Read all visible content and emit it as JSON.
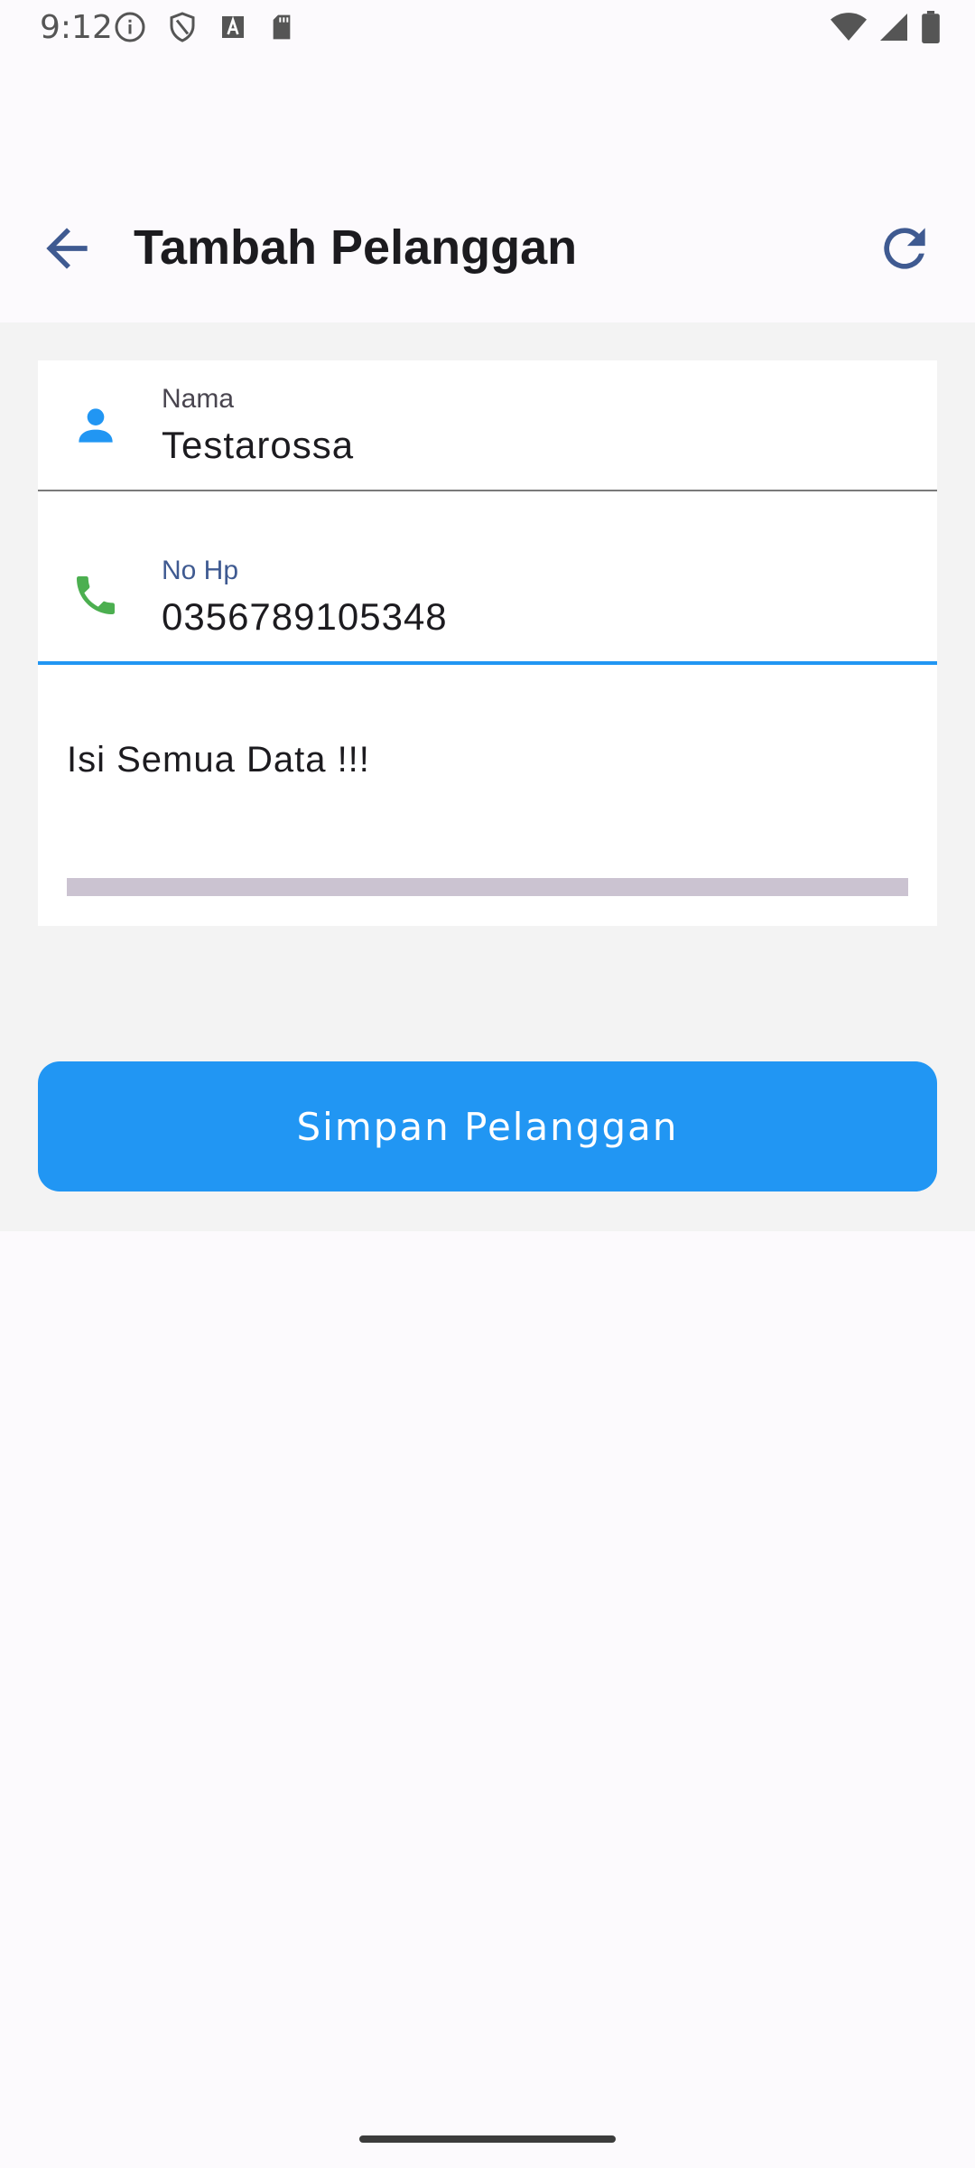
{
  "status_bar": {
    "time": "9:12",
    "left_icons": [
      "info-icon",
      "shield-icon",
      "font-icon",
      "sd-card-icon"
    ],
    "right_icons": [
      "wifi-icon",
      "signal-icon",
      "battery-icon"
    ]
  },
  "app_bar": {
    "title": "Tambah Pelanggan",
    "back_icon": "arrow-back-icon",
    "refresh_icon": "refresh-icon"
  },
  "form": {
    "nama": {
      "label": "Nama",
      "value": "Testarossa",
      "icon": "person-icon"
    },
    "no_hp": {
      "label": "No Hp",
      "value": "0356789105348",
      "icon": "phone-icon"
    },
    "message": "Isi Semua Data !!!",
    "progress": 0
  },
  "save_button": {
    "label": "Simpan Pelanggan"
  },
  "colors": {
    "primary": "#2196f3",
    "phone_icon": "#4caf50",
    "background": "#fcfafd",
    "content_bg": "#f3f3f3"
  }
}
